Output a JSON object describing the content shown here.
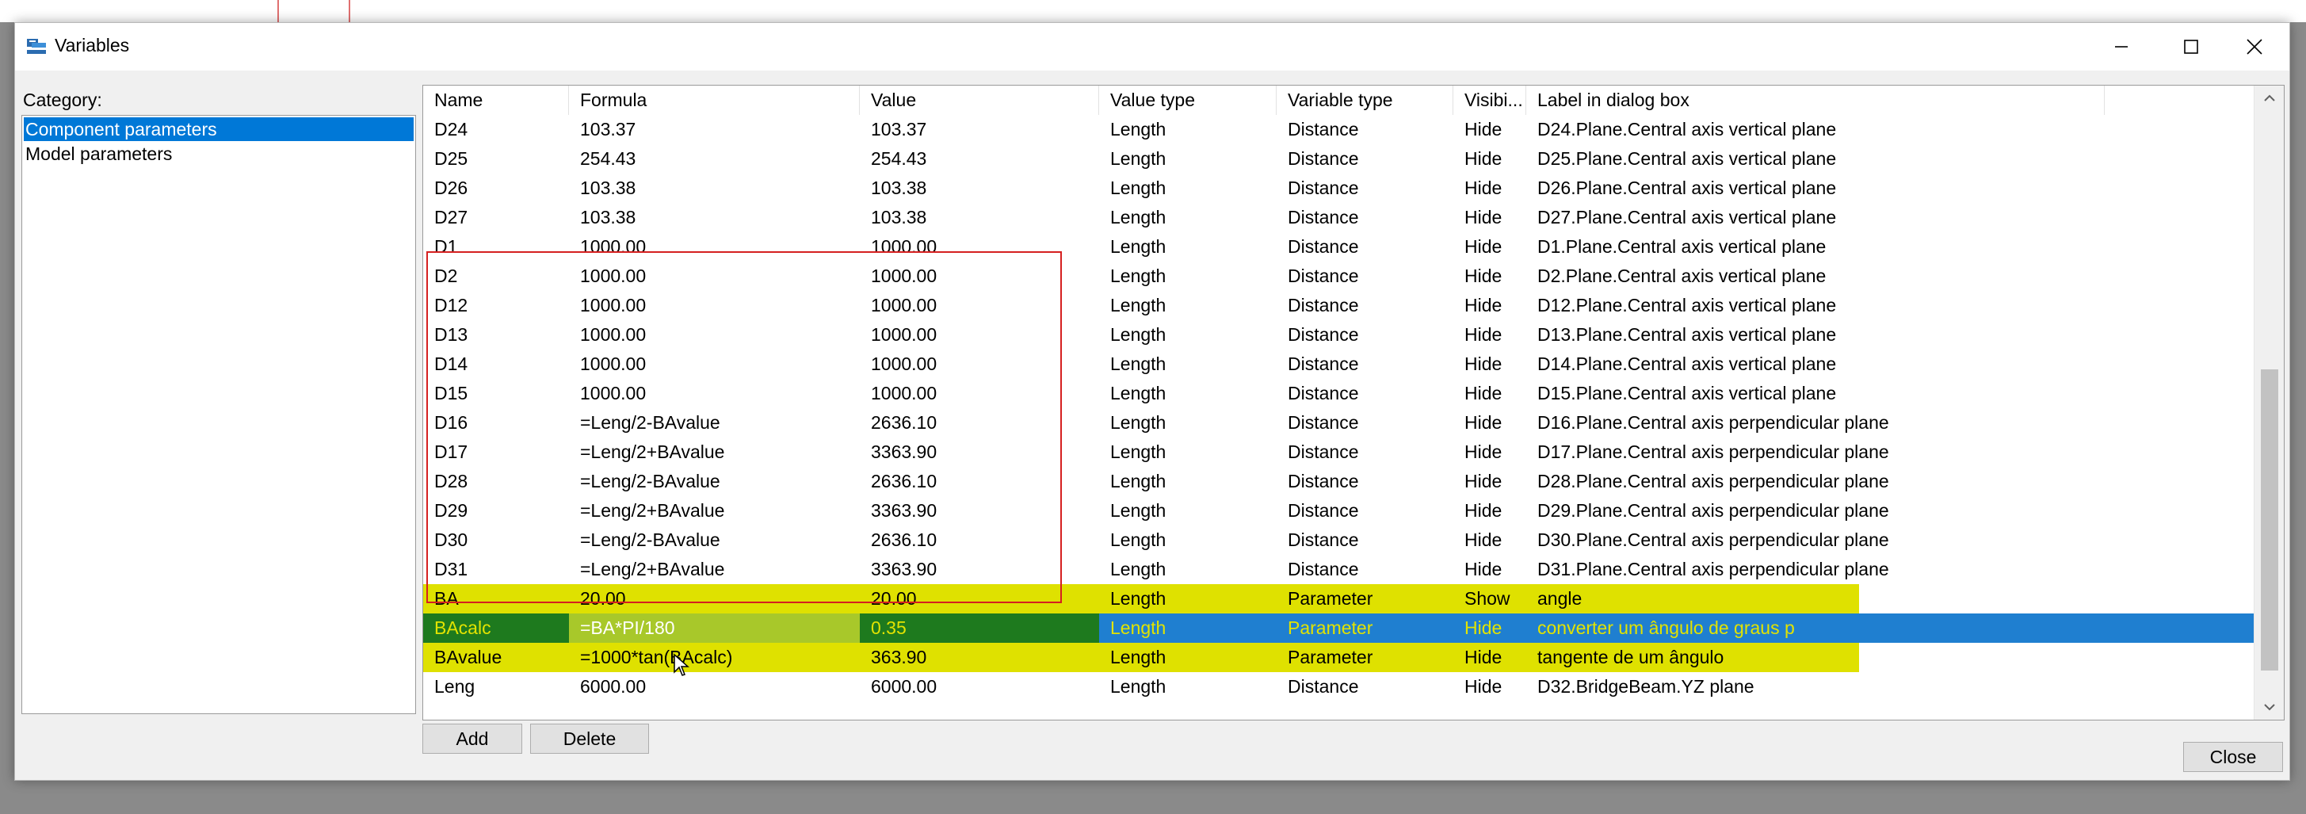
{
  "window": {
    "title": "Variables"
  },
  "category": {
    "label": "Category:",
    "items": [
      "Component parameters",
      "Model parameters"
    ],
    "selected_index": 0
  },
  "table": {
    "columns": [
      "Name",
      "Formula",
      "Value",
      "Value type",
      "Variable type",
      "Visibi...",
      "Label in dialog box"
    ],
    "rows": [
      [
        "D24",
        "103.37",
        "103.37",
        "Length",
        "Distance",
        "Hide",
        "D24.Plane.Central axis vertical plane"
      ],
      [
        "D25",
        "254.43",
        "254.43",
        "Length",
        "Distance",
        "Hide",
        "D25.Plane.Central axis vertical plane"
      ],
      [
        "D26",
        "103.38",
        "103.38",
        "Length",
        "Distance",
        "Hide",
        "D26.Plane.Central axis vertical plane"
      ],
      [
        "D27",
        "103.38",
        "103.38",
        "Length",
        "Distance",
        "Hide",
        "D27.Plane.Central axis vertical plane"
      ],
      [
        "D1",
        "1000.00",
        "1000.00",
        "Length",
        "Distance",
        "Hide",
        "D1.Plane.Central axis vertical plane"
      ],
      [
        "D2",
        "1000.00",
        "1000.00",
        "Length",
        "Distance",
        "Hide",
        "D2.Plane.Central axis vertical plane"
      ],
      [
        "D12",
        "1000.00",
        "1000.00",
        "Length",
        "Distance",
        "Hide",
        "D12.Plane.Central axis vertical plane"
      ],
      [
        "D13",
        "1000.00",
        "1000.00",
        "Length",
        "Distance",
        "Hide",
        "D13.Plane.Central axis vertical plane"
      ],
      [
        "D14",
        "1000.00",
        "1000.00",
        "Length",
        "Distance",
        "Hide",
        "D14.Plane.Central axis vertical plane"
      ],
      [
        "D15",
        "1000.00",
        "1000.00",
        "Length",
        "Distance",
        "Hide",
        "D15.Plane.Central axis vertical plane"
      ],
      [
        "D16",
        "=Leng/2-BAvalue",
        "2636.10",
        "Length",
        "Distance",
        "Hide",
        "D16.Plane.Central axis perpendicular plane"
      ],
      [
        "D17",
        "=Leng/2+BAvalue",
        "3363.90",
        "Length",
        "Distance",
        "Hide",
        "D17.Plane.Central axis perpendicular plane"
      ],
      [
        "D28",
        "=Leng/2-BAvalue",
        "2636.10",
        "Length",
        "Distance",
        "Hide",
        "D28.Plane.Central axis perpendicular plane"
      ],
      [
        "D29",
        "=Leng/2+BAvalue",
        "3363.90",
        "Length",
        "Distance",
        "Hide",
        "D29.Plane.Central axis perpendicular plane"
      ],
      [
        "D30",
        "=Leng/2-BAvalue",
        "2636.10",
        "Length",
        "Distance",
        "Hide",
        "D30.Plane.Central axis perpendicular plane"
      ],
      [
        "D31",
        "=Leng/2+BAvalue",
        "3363.90",
        "Length",
        "Distance",
        "Hide",
        "D31.Plane.Central axis perpendicular plane"
      ],
      [
        "BA",
        "20.00",
        "20.00",
        "Length",
        "Parameter",
        "Show",
        "angle"
      ],
      [
        "BAcalc",
        "=BA*PI/180",
        "0.35",
        "Length",
        "Parameter",
        "Hide",
        "converter um ângulo de graus p"
      ],
      [
        "BAvalue",
        "=1000*tan(BAcalc)",
        "363.90",
        "Length",
        "Parameter",
        "Hide",
        "tangente de um ângulo"
      ],
      [
        "Leng",
        "6000.00",
        "6000.00",
        "Length",
        "Distance",
        "Hide",
        "D32.BridgeBeam.YZ plane"
      ]
    ],
    "highlighted_rows": [
      16,
      17,
      18
    ],
    "selected_row": 17
  },
  "buttons": {
    "add": "Add",
    "delete": "Delete",
    "close": "Close"
  },
  "colors": {
    "selection": "#0078d7",
    "highlight": "#dfe100",
    "annotation_box": "#d52020",
    "selected_cell": "#1e7a1e"
  },
  "icons": {
    "app": "variables-app-icon",
    "minimize": "minimize-icon",
    "maximize": "maximize-icon",
    "close": "close-icon",
    "scroll_up": "chevron-up-icon",
    "scroll_down": "chevron-down-icon"
  }
}
